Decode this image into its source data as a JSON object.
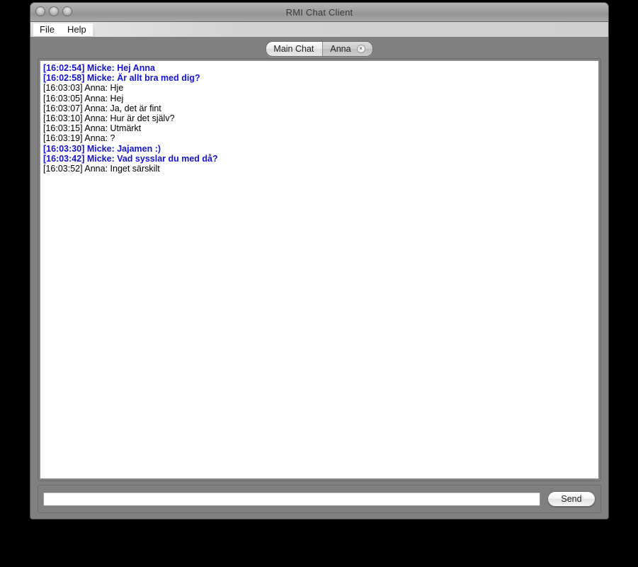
{
  "window": {
    "title": "RMI Chat Client",
    "controls": [
      {
        "name": "close-button"
      },
      {
        "name": "minimize-button"
      },
      {
        "name": "zoom-button"
      }
    ]
  },
  "menubar": {
    "items": [
      {
        "label": "File"
      },
      {
        "label": "Help"
      }
    ]
  },
  "tabs": [
    {
      "label": "Main Chat",
      "selected": false,
      "closable": false
    },
    {
      "label": "Anna",
      "selected": true,
      "closable": true,
      "close_glyph": "×"
    }
  ],
  "chat": {
    "messages": [
      {
        "text": "[16:02:54] Micke: Hej Anna",
        "self": true
      },
      {
        "text": "[16:02:58] Micke: Är allt bra med dig?",
        "self": true
      },
      {
        "text": "[16:03:03] Anna: Hje",
        "self": false
      },
      {
        "text": "[16:03:05] Anna: Hej",
        "self": false
      },
      {
        "text": "[16:03:07] Anna: Ja, det är fint",
        "self": false
      },
      {
        "text": "[16:03:10] Anna: Hur är det själv?",
        "self": false
      },
      {
        "text": "[16:03:15] Anna: Utmärkt",
        "self": false
      },
      {
        "text": "[16:03:19] Anna: ?",
        "self": false
      },
      {
        "text": "[16:03:30] Micke: Jajamen :)",
        "self": true
      },
      {
        "text": "[16:03:42] Micke: Vad sysslar du med då?",
        "self": true
      },
      {
        "text": "[16:03:52] Anna: Inget särskilt",
        "self": false
      }
    ]
  },
  "composer": {
    "input_value": "",
    "input_placeholder": "",
    "send_label": "Send"
  },
  "colors": {
    "self_message": "#1414d2",
    "other_message": "#000000",
    "window_background": "#808080",
    "chat_background": "#ffffff",
    "desktop_background": "#000000"
  }
}
